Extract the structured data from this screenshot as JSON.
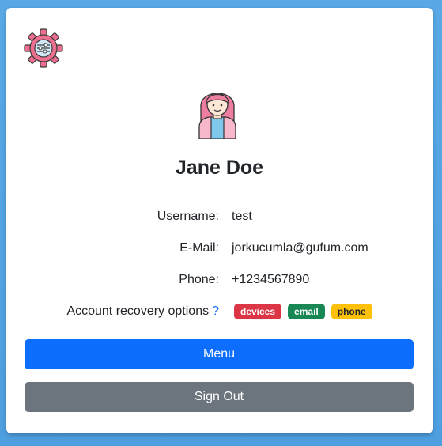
{
  "profile": {
    "name": "Jane Doe",
    "rows": [
      {
        "label": "Username:",
        "value": "test"
      },
      {
        "label": "E-Mail:",
        "value": "jorkucumla@gufum.com"
      },
      {
        "label": "Phone:",
        "value": "+1234567890"
      }
    ],
    "recovery": {
      "label": "Account recovery options",
      "help": "?",
      "badges": [
        {
          "label": "devices",
          "bg": "#dc3545",
          "fg": "#ffffff"
        },
        {
          "label": "email",
          "bg": "#198754",
          "fg": "#ffffff"
        },
        {
          "label": "phone",
          "bg": "#ffc107",
          "fg": "#212529"
        }
      ]
    }
  },
  "buttons": {
    "menu_label": "Menu",
    "signout_label": "Sign Out"
  },
  "colors": {
    "primary": "#0d6efd",
    "secondary": "#6c757d",
    "background": "#5aa9e6"
  },
  "icons": {
    "settings": "settings-gear-icon",
    "avatar": "user-avatar-icon"
  }
}
